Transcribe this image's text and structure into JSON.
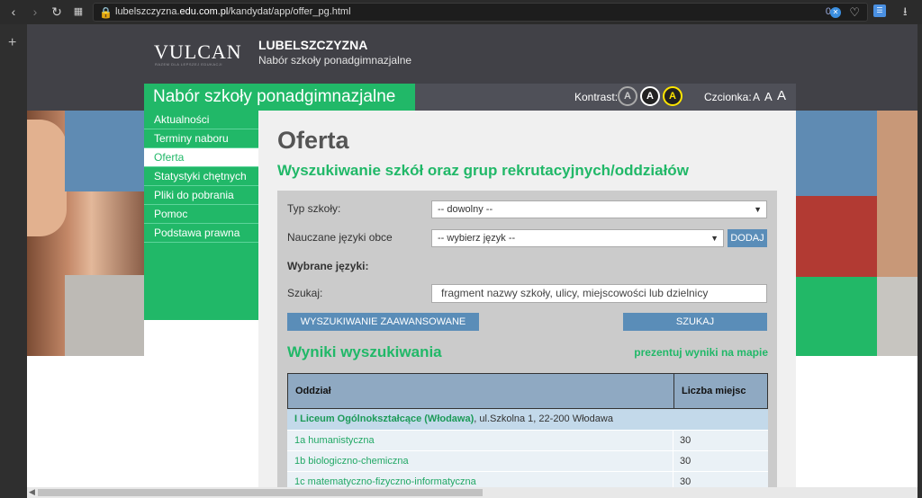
{
  "browser": {
    "url_prefix": "lubelszczyzna.",
    "url_host": "edu.com.pl",
    "url_path": "/kandydat/app/offer_pg.html",
    "counter": "0"
  },
  "header": {
    "logo": "VULCAN",
    "logo_sub": "RAZEM DLA LEPSZEJ EDUKACJI",
    "region": "LUBELSZCZYZNA",
    "region_sub": "Nabór szkoły ponadgimnazjalne"
  },
  "title_band": {
    "title": "Nabór szkoły ponadgimnazjalne",
    "contrast_label": "Kontrast:",
    "contrast_options": [
      "A",
      "A",
      "A"
    ],
    "font_label": "Czcionka:",
    "font_options": [
      "A",
      "A",
      "A"
    ]
  },
  "nav": {
    "items": [
      "Aktualności",
      "Terminy naboru",
      "Oferta",
      "Statystyki chętnych",
      "Pliki do pobrania",
      "Pomoc",
      "Podstawa prawna"
    ],
    "active": "Oferta"
  },
  "main": {
    "title": "Oferta",
    "subtitle": "Wyszukiwanie szkół oraz grup rekrutacyjnych/oddziałów"
  },
  "search": {
    "school_type_label": "Typ szkoły:",
    "school_type_value": "-- dowolny --",
    "languages_label": "Nauczane języki obce",
    "languages_value": "-- wybierz język --",
    "add_button": "DODAJ",
    "selected_label": "Wybrane języki:",
    "query_label": "Szukaj:",
    "query_placeholder": "fragment nazwy szkoły, ulicy, miejscowości lub dzielnicy",
    "advanced_button": "WYSZUKIWANIE ZAAWANSOWANE",
    "search_button": "SZUKAJ"
  },
  "results": {
    "title": "Wyniki wyszukiwania",
    "map_link": "prezentuj wyniki na mapie",
    "col_branch": "Oddział",
    "col_places": "Liczba miejsc",
    "school_name": "I Liceum Ogólnokształcące (Włodawa)",
    "school_address": ", ul.Szkolna 1, 22-200 Włodawa",
    "rows": [
      {
        "name": "1a humanistyczna",
        "places": "30"
      },
      {
        "name": "1b biologiczno-chemiczna",
        "places": "30"
      },
      {
        "name": "1c matematyczno-fizyczno-informatyczna",
        "places": "30"
      }
    ]
  },
  "colors": {
    "green": "#21b868",
    "header_dark": "#414147",
    "table_head": "#8fa9c2"
  }
}
